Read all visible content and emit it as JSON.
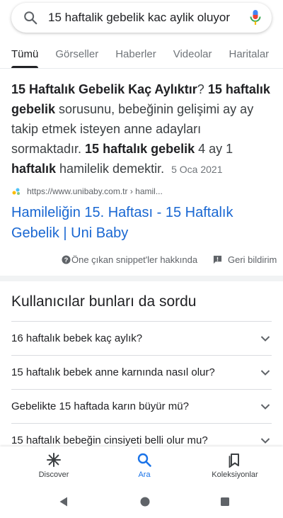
{
  "search": {
    "query": "15 haftalik gebelik kac aylik oluyor"
  },
  "tabs": [
    {
      "label": "Tümü",
      "active": true
    },
    {
      "label": "Görseller"
    },
    {
      "label": "Haberler"
    },
    {
      "label": "Videolar"
    },
    {
      "label": "Haritalar"
    }
  ],
  "snippet": {
    "parts": {
      "b1": "15 Haftalık Gebelik Kaç Aylıktır",
      "t1": "? ",
      "b2": "15 haftalık gebelik",
      "t2": " sorusunu, bebeğinin gelişimi ay ay takip etmek isteyen anne adayları sormaktadır. ",
      "b3": "15 haftalık gebelik",
      "t3": " 4 ay 1 ",
      "b4": "haftalık",
      "t4": " hamilelik demektir."
    },
    "date": "5 Oca 2021",
    "source_url": "https://www.unibaby.com.tr › hamil...",
    "result_title": "Hamileliğin 15. Haftası - 15 Haftalık Gebelik | Uni Baby"
  },
  "meta": {
    "about_label": "Öne çıkan snippet'ler hakkında",
    "feedback_label": "Geri bildirim"
  },
  "paa": {
    "title": "Kullanıcılar bunları da sordu",
    "items": [
      "16 haftalık bebek kaç aylık?",
      "15 haftalık bebek anne karnında nasıl olur?",
      "Gebelikte 15 haftada karın büyür mü?",
      "15 haftalık bebeğin cinsiyeti belli olur mu?"
    ]
  },
  "bottom_nav": [
    {
      "label": "Discover",
      "icon": "asterisk-icon"
    },
    {
      "label": "Ara",
      "icon": "search-icon",
      "active": true
    },
    {
      "label": "Koleksiyonlar",
      "icon": "bookmark-collections-icon"
    }
  ],
  "colors": {
    "link": "#1967d2",
    "active_nav": "#1a73e8",
    "text": "#202124"
  }
}
